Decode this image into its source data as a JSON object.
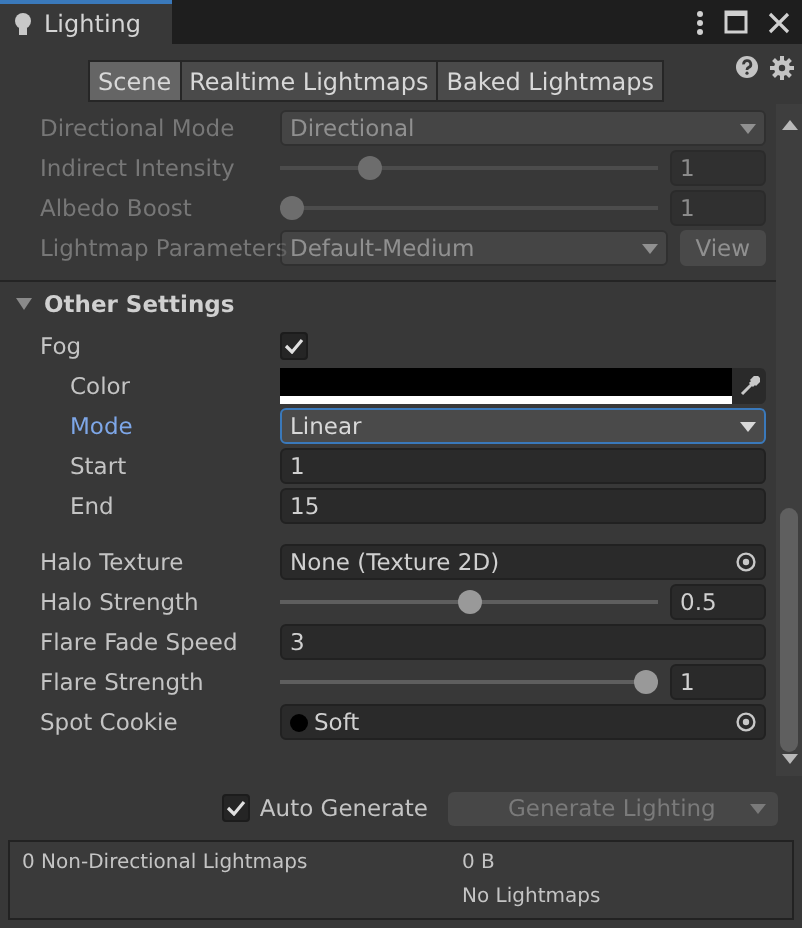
{
  "window": {
    "title": "Lighting"
  },
  "tabs": [
    {
      "label": "Scene",
      "selected": true
    },
    {
      "label": "Realtime Lightmaps",
      "selected": false
    },
    {
      "label": "Baked Lightmaps",
      "selected": false
    }
  ],
  "lightmapping_settings": [
    {
      "kind": "dropdown",
      "label": "Directional Mode",
      "value": "Directional",
      "disabled": true
    },
    {
      "kind": "slider",
      "label": "Indirect Intensity",
      "level": 0.22,
      "value": "1",
      "disabled": true
    },
    {
      "kind": "slider",
      "label": "Albedo Boost",
      "level": 0,
      "value": "1",
      "disabled": true
    },
    {
      "kind": "asset",
      "label": "Lightmap Parameters",
      "value": "Default-Medium",
      "button": "View",
      "disabled": true
    }
  ],
  "other_settings": {
    "title": "Other Settings",
    "expanded": true,
    "rows": [
      {
        "kind": "checkbox",
        "label": "Fog",
        "checked": true,
        "children": [
          {
            "kind": "color",
            "label": "Color",
            "color": "#000000",
            "focused": false
          },
          {
            "kind": "dropdown",
            "label": "Mode",
            "value": "Linear",
            "focused": true
          },
          {
            "kind": "number",
            "label": "Start",
            "value": "1",
            "focused": false
          },
          {
            "kind": "number",
            "label": "End",
            "value": "15",
            "focused": false
          }
        ]
      },
      {
        "kind": "object",
        "label": "Halo Texture",
        "value": "None (Texture 2D)"
      },
      {
        "kind": "slider",
        "label": "Halo Strength",
        "level": 0.5,
        "value": "0.5"
      },
      {
        "kind": "number",
        "label": "Flare Fade Speed",
        "value": "3"
      },
      {
        "kind": "slider",
        "label": "Flare Strength",
        "level": 1,
        "value": "1"
      },
      {
        "kind": "texture",
        "label": "Spot Cookie",
        "value": "Soft"
      }
    ]
  },
  "auto_generate": {
    "label": "Auto Generate",
    "checked": true
  },
  "generate_button": {
    "label": "Generate Lighting",
    "disabled": true
  },
  "lightmap_info": {
    "column_1": "0 Non-Directional Lightmaps",
    "column_2": [
      "0 B",
      "No Lightmaps"
    ]
  }
}
